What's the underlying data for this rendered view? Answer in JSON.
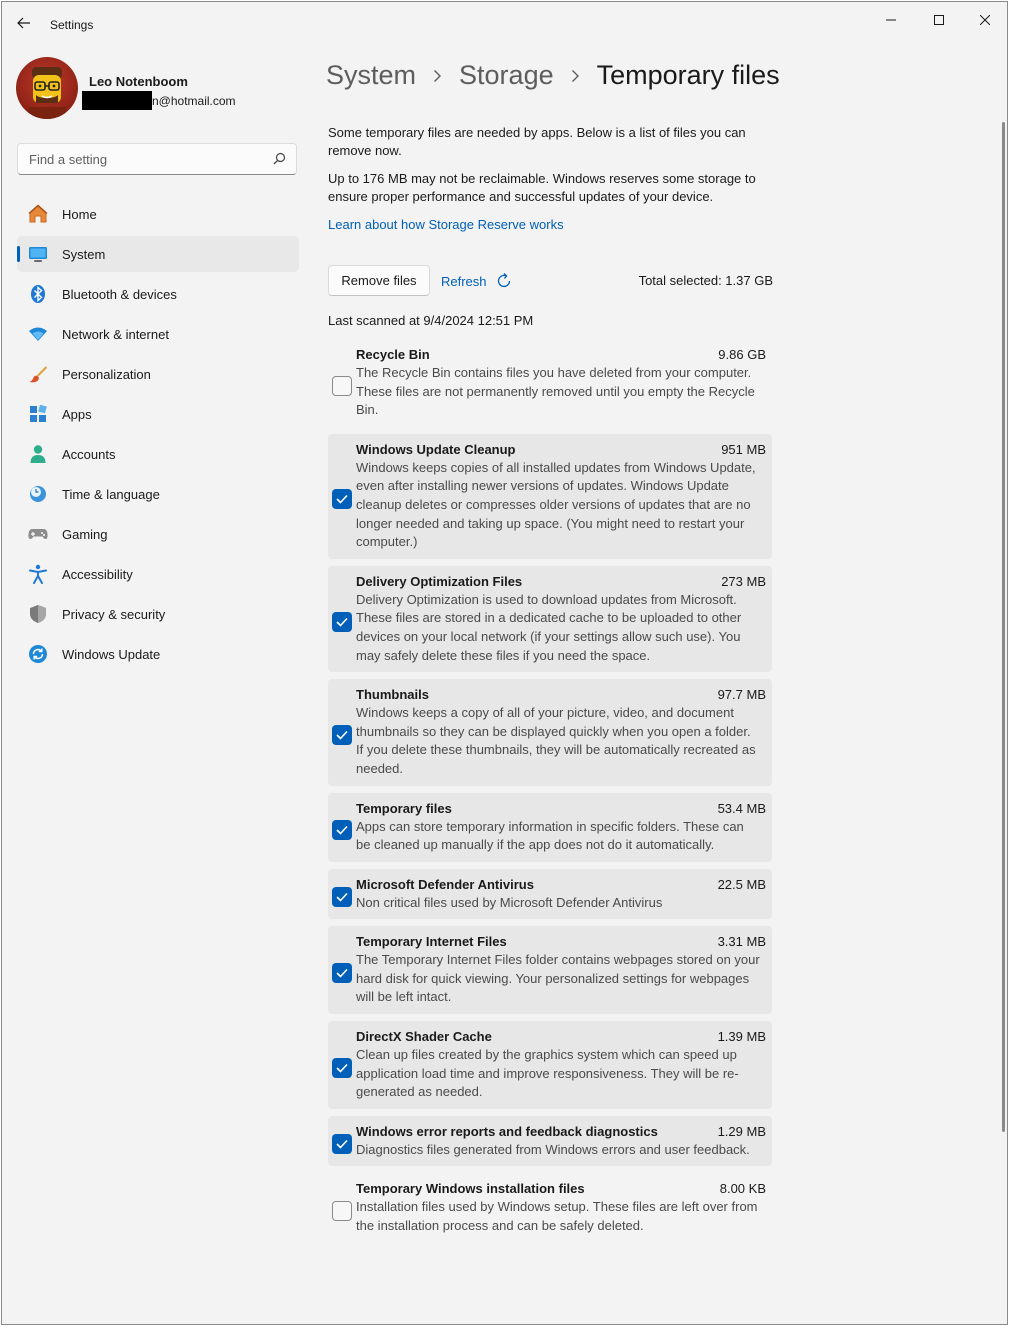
{
  "window": {
    "title": "Settings"
  },
  "profile": {
    "name": "Leo Notenboom",
    "email_suffix": "n@hotmail.com"
  },
  "search": {
    "placeholder": "Find a setting"
  },
  "nav": [
    {
      "label": "Home",
      "icon": "home-icon"
    },
    {
      "label": "System",
      "icon": "system-icon",
      "active": true
    },
    {
      "label": "Bluetooth & devices",
      "icon": "bluetooth-icon"
    },
    {
      "label": "Network & internet",
      "icon": "wifi-icon"
    },
    {
      "label": "Personalization",
      "icon": "brush-icon"
    },
    {
      "label": "Apps",
      "icon": "apps-icon"
    },
    {
      "label": "Accounts",
      "icon": "account-icon"
    },
    {
      "label": "Time & language",
      "icon": "clock-globe-icon"
    },
    {
      "label": "Gaming",
      "icon": "gamepad-icon"
    },
    {
      "label": "Accessibility",
      "icon": "accessibility-icon"
    },
    {
      "label": "Privacy & security",
      "icon": "shield-icon"
    },
    {
      "label": "Windows Update",
      "icon": "update-icon"
    }
  ],
  "breadcrumb": {
    "level1": "System",
    "level2": "Storage",
    "current": "Temporary files"
  },
  "intro": {
    "p1": "Some temporary files are needed by apps. Below is a list of files you can remove now.",
    "p2": "Up to 176 MB may not be reclaimable. Windows reserves some storage to ensure proper performance and successful updates of your device.",
    "link": "Learn about how Storage Reserve works"
  },
  "actions": {
    "remove": "Remove files",
    "refresh": "Refresh",
    "total": "Total selected: 1.37 GB"
  },
  "last_scanned": "Last scanned at 9/4/2024 12:51 PM",
  "files": [
    {
      "name": "Recycle Bin",
      "size": "9.86 GB",
      "checked": false,
      "desc": "The Recycle Bin contains files you have deleted from your computer. These files are not permanently removed until you empty the Recycle Bin."
    },
    {
      "name": "Windows Update Cleanup",
      "size": "951 MB",
      "checked": true,
      "desc": "Windows keeps copies of all installed updates from Windows Update, even after installing newer versions of updates. Windows Update cleanup deletes or compresses older versions of updates that are no longer needed and taking up space. (You might need to restart your computer.)"
    },
    {
      "name": "Delivery Optimization Files",
      "size": "273 MB",
      "checked": true,
      "desc": "Delivery Optimization is used to download updates from Microsoft. These files are stored in a dedicated cache to be uploaded to other devices on your local network (if your settings allow such use). You may safely delete these files if you need the space."
    },
    {
      "name": "Thumbnails",
      "size": "97.7 MB",
      "checked": true,
      "desc": "Windows keeps a copy of all of your picture, video, and document thumbnails so they can be displayed quickly when you open a folder. If you delete these thumbnails, they will be automatically recreated as needed."
    },
    {
      "name": "Temporary files",
      "size": "53.4 MB",
      "checked": true,
      "desc": "Apps can store temporary information in specific folders. These can be cleaned up manually if the app does not do it automatically."
    },
    {
      "name": "Microsoft Defender Antivirus",
      "size": "22.5 MB",
      "checked": true,
      "desc": "Non critical files used by Microsoft Defender Antivirus"
    },
    {
      "name": "Temporary Internet Files",
      "size": "3.31 MB",
      "checked": true,
      "desc": "The Temporary Internet Files folder contains webpages stored on your hard disk for quick viewing. Your personalized settings for webpages will be left intact."
    },
    {
      "name": "DirectX Shader Cache",
      "size": "1.39 MB",
      "checked": true,
      "desc": "Clean up files created by the graphics system which can speed up application load time and improve responsiveness. They will be re-generated as needed."
    },
    {
      "name": "Windows error reports and feedback diagnostics",
      "size": "1.29 MB",
      "checked": true,
      "desc": "Diagnostics files generated from Windows errors and user feedback."
    },
    {
      "name": "Temporary Windows installation files",
      "size": "8.00 KB",
      "checked": false,
      "desc": "Installation files used by Windows setup.  These files are left over from the installation process and can be safely deleted."
    }
  ],
  "colors": {
    "accent": "#005fb8",
    "window_bg": "#f3f3f3",
    "card_bg": "#e7e7e7"
  }
}
